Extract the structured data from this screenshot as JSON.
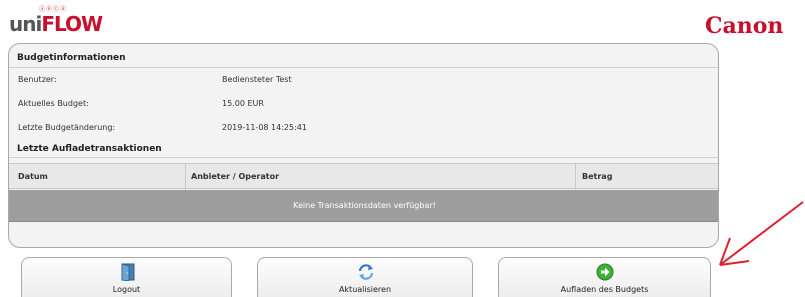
{
  "header": {
    "brand_small": "ⓐⓑⓒⓓ",
    "brand_uni": "uni",
    "brand_flow": "FLOW",
    "brand_right": "Canon"
  },
  "budget_info": {
    "title": "Budgetinformationen",
    "rows": [
      {
        "label": "Benutzer:",
        "value": "Bediensteter Test"
      },
      {
        "label": "Aktuelles Budget:",
        "value": "15.00 EUR"
      },
      {
        "label": "Letzte Budgetänderung:",
        "value": "2019-11-08 14:25:41"
      }
    ]
  },
  "transactions": {
    "title": "Letzte Aufladetransaktionen",
    "columns": [
      "Datum",
      "Anbieter / Operator",
      "Betrag"
    ],
    "empty_message": "Keine Transaktionsdaten verfügbar!"
  },
  "actions": {
    "logout": "Logout",
    "refresh": "Aktualisieren",
    "charge": "Aufladen des Budgets"
  },
  "colors": {
    "brand_red": "#c8102e",
    "panel_bg": "#f3f3f3",
    "empty_row_bg": "#9e9e9e",
    "annotation_arrow": "#e0202e"
  },
  "icons": {
    "logout": "door-exit-icon",
    "refresh": "refresh-arrows-icon",
    "charge": "green-arrow-right-icon"
  }
}
